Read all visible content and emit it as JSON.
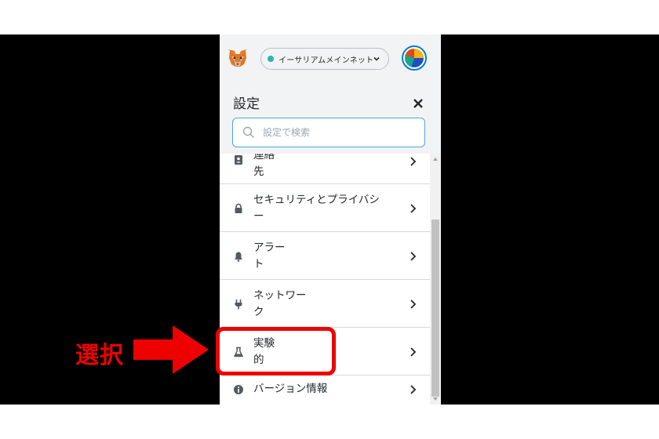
{
  "header": {
    "network_label": "イーサリアムメインネット",
    "network_dot_color": "#29b6af",
    "logo_icon": "metamask-fox-icon",
    "avatar_icon": "account-identicon"
  },
  "settings": {
    "title": "設定",
    "close_icon": "close-icon",
    "search_placeholder": "設定で検索",
    "search_value": ""
  },
  "menu": {
    "items": [
      {
        "label": "連絡\n先",
        "icon": "contacts-icon"
      },
      {
        "label": "セキュリティとプライバシ\nー",
        "icon": "lock-icon"
      },
      {
        "label": "アラー\nト",
        "icon": "bell-icon"
      },
      {
        "label": "ネットワー\nク",
        "icon": "plug-icon"
      },
      {
        "label": "実験\n的",
        "icon": "flask-icon"
      },
      {
        "label": "バージョン情報",
        "icon": "info-icon"
      }
    ]
  },
  "annotation": {
    "text": "選択",
    "color": "#ee0000"
  }
}
